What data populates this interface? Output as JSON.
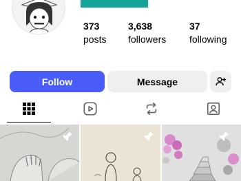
{
  "profile": {
    "avatar_icon": "profile-avatar-illustration",
    "accent_color": "#15a39a"
  },
  "stats": {
    "posts": {
      "value": "373",
      "label": "posts"
    },
    "followers": {
      "value": "3,638",
      "label": "followers"
    },
    "following": {
      "value": "37",
      "label": "following"
    }
  },
  "actions": {
    "follow_label": "Follow",
    "follow_color": "#4a5df9",
    "message_label": "Message",
    "add_user_icon": "add-user-icon"
  },
  "tabs": [
    {
      "icon": "grid-icon",
      "selected": true
    },
    {
      "icon": "reels-icon",
      "selected": false
    },
    {
      "icon": "reposts-icon",
      "selected": false
    },
    {
      "icon": "tagged-icon",
      "selected": false
    }
  ],
  "posts": [
    {
      "description_icon": "pencil-sketch-hands",
      "pinned": true
    },
    {
      "description_icon": "pencil-sketch-couple",
      "pinned": true
    },
    {
      "description_icon": "sketch-garden-stairs",
      "pinned": true
    }
  ]
}
